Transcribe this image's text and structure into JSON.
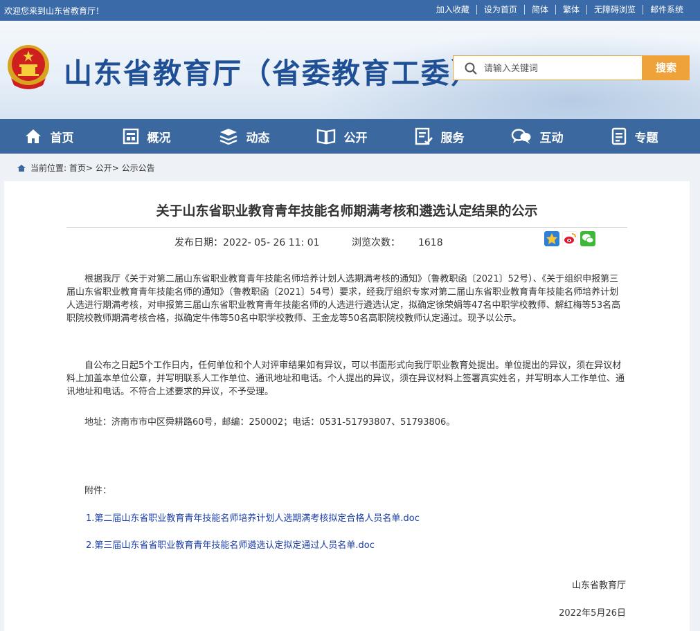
{
  "topbar": {
    "welcome": "欢迎您来到山东省教育厅！",
    "links": [
      "加入收藏",
      "设为首页",
      "简体",
      "繁体",
      "无障碍浏览",
      "邮件系统"
    ]
  },
  "header": {
    "site_title": "山东省教育厅（省委教育工委）",
    "search_placeholder": "请输入关键词",
    "search_button": "搜索"
  },
  "nav": [
    {
      "label": "首页",
      "icon": "home-icon"
    },
    {
      "label": "概况",
      "icon": "overview-icon"
    },
    {
      "label": "动态",
      "icon": "news-icon"
    },
    {
      "label": "公开",
      "icon": "book-icon"
    },
    {
      "label": "服务",
      "icon": "service-icon"
    },
    {
      "label": "互动",
      "icon": "chat-icon"
    },
    {
      "label": "专题",
      "icon": "topic-icon"
    }
  ],
  "breadcrumb": "当前位置: 首页> 公开> 公示公告",
  "article": {
    "title": "关于山东省职业教育青年技能名师期满考核和遴选认定结果的公示",
    "publish_label": "发布日期：",
    "publish_date": "2022- 05- 26 11: 01",
    "views_label": "浏览次数：",
    "views": "1618",
    "paragraphs": [
      "根据我厅《关于对第二届山东省职业教育青年技能名师培养计划人选期满考核的通知》（鲁教职函〔2021〕52号）、《关于组织申报第三届山东省职业教育青年技能名师的通知》（鲁教职函〔2021〕54号）要求，经我厅组织专家对第二届山东省职业教育青年技能名师培养计划人选进行期满考核，对申报第三届山东省职业教育青年技能名师的人选进行遴选认定，拟确定徐荣娟等47名中职学校教师、解红梅等53名高职院校教师期满考核合格，拟确定牛伟等50名中职学校教师、王金龙等50名高职院校教师认定通过。现予以公示。",
      "自公布之日起5个工作日内，任何单位和个人对评审结果如有异议，可以书面形式向我厅职业教育处提出。单位提出的异议，须在异议材料上加盖本单位公章，并写明联系人工作单位、通讯地址和电话。个人提出的异议，须在异议材料上签署真实姓名，并写明本人工作单位、通讯地址和电话。不符合上述要求的异议，不予受理。",
      "地址：济南市市中区舜耕路60号，邮编：250002；电话：0531-51793807、51793806。",
      "附件："
    ],
    "attachments": [
      "1.第二届山东省职业教育青年技能名师培养计划人选期满考核拟定合格人员名单.doc",
      "2.第三届山东省省职业教育青年技能名师遴选认定拟定通过人员名单.doc"
    ],
    "sign_org": "山东省教育厅",
    "sign_date": "2022年5月26日"
  },
  "colors": {
    "nav_bg": "#3b689f",
    "topbar_bg": "#3a6aa8",
    "title_blue": "#1f4f94",
    "search_orange": "#f0a23a",
    "link_blue": "#1b3fa8"
  }
}
